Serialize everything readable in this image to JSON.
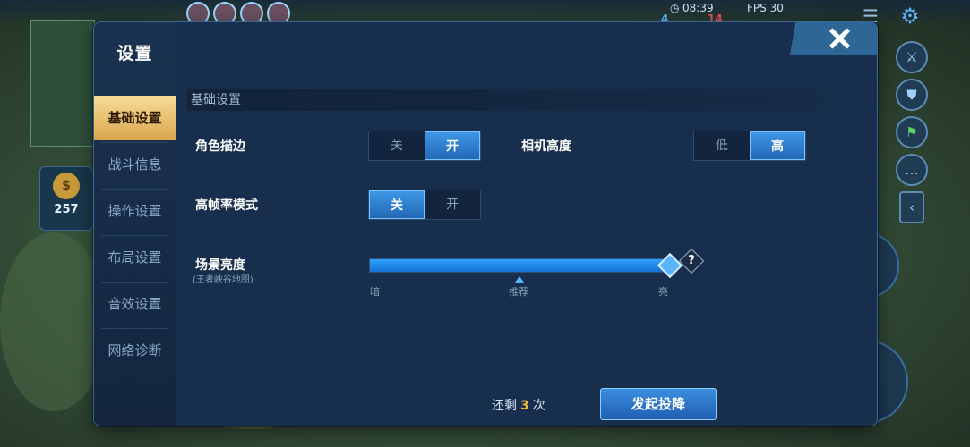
{
  "hud": {
    "time": "08:39",
    "fps": "FPS 30",
    "gold": "257",
    "score_blue": "4",
    "score_red": "14"
  },
  "dialog": {
    "title": "设置",
    "sidebar": {
      "items": [
        {
          "label": "基础设置",
          "active": true
        },
        {
          "label": "战斗信息",
          "active": false
        },
        {
          "label": "操作设置",
          "active": false
        },
        {
          "label": "布局设置",
          "active": false
        },
        {
          "label": "音效设置",
          "active": false
        },
        {
          "label": "网络诊断",
          "active": false
        }
      ]
    },
    "section_header": "基础设置",
    "settings": {
      "outline": {
        "label": "角色描边",
        "off": "关",
        "on": "开",
        "selected": "开"
      },
      "camera": {
        "label": "相机高度",
        "low": "低",
        "high": "高",
        "selected": "高"
      },
      "high_fps": {
        "label": "高帧率模式",
        "off": "关",
        "on": "开",
        "selected": "关"
      },
      "brightness": {
        "label": "场景亮度",
        "sublabel": "(王者峡谷地图)",
        "value": 1.0,
        "tick_dark": "暗",
        "tick_recommend": "推荐",
        "tick_bright": "亮",
        "help": "?"
      }
    },
    "footer": {
      "remaining_prefix": "还剩",
      "remaining_count": "3",
      "remaining_suffix": "次",
      "surrender_label": "发起投降"
    }
  }
}
